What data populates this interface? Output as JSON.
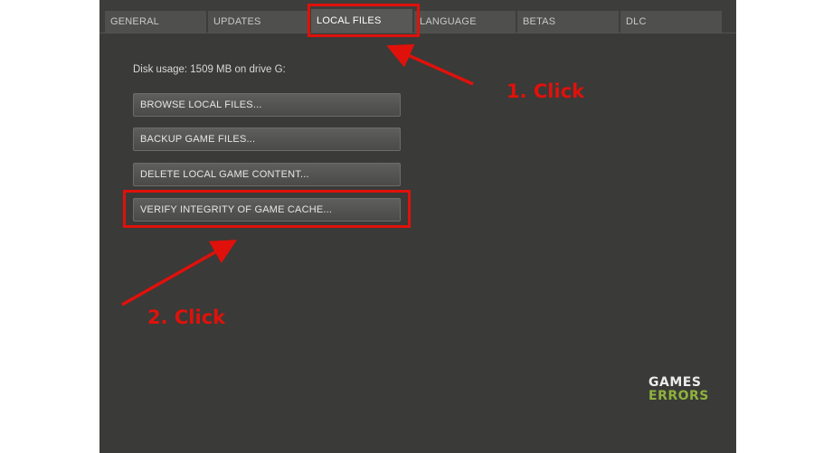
{
  "tabs": [
    {
      "label": "GENERAL",
      "active": false
    },
    {
      "label": "UPDATES",
      "active": false
    },
    {
      "label": "LOCAL FILES",
      "active": true
    },
    {
      "label": "LANGUAGE",
      "active": false
    },
    {
      "label": "BETAS",
      "active": false
    },
    {
      "label": "DLC",
      "active": false
    }
  ],
  "local_files": {
    "disk_usage": "Disk usage: 1509 MB on drive G:",
    "buttons": {
      "browse": "BROWSE LOCAL FILES...",
      "backup": "BACKUP GAME FILES...",
      "delete": "DELETE LOCAL GAME CONTENT...",
      "verify": "VERIFY INTEGRITY OF GAME CACHE..."
    }
  },
  "annotations": {
    "step1": "1. Click",
    "step2": "2. Click",
    "color": "#e0110b"
  },
  "watermark": {
    "line1": "GAMES",
    "line2": "ERRORS"
  }
}
